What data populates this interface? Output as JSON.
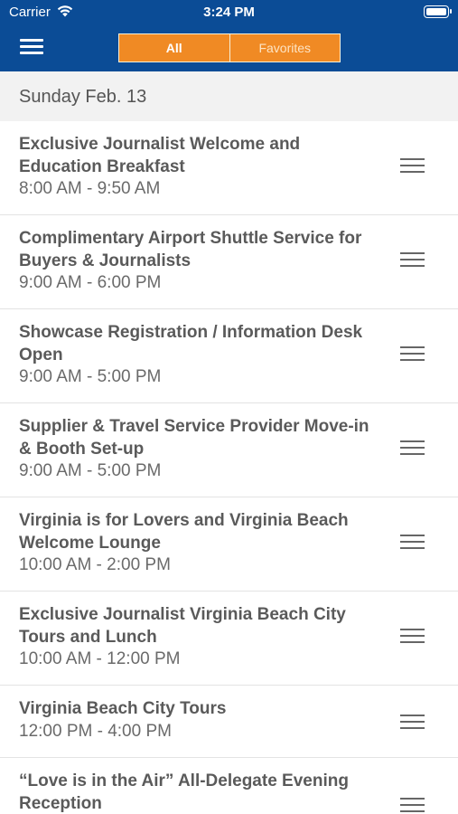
{
  "status_bar": {
    "carrier": "Carrier",
    "time": "3:24 PM"
  },
  "nav": {
    "menu_icon": "hamburger-icon",
    "tabs": [
      {
        "label": "All",
        "active": true
      },
      {
        "label": "Favorites",
        "active": false
      }
    ]
  },
  "day": {
    "label": "Sunday Feb. 13"
  },
  "events": [
    {
      "title": "Exclusive Journalist Welcome and Education Breakfast",
      "time": "8:00 AM - 9:50 AM"
    },
    {
      "title": "Complimentary Airport Shuttle Service for Buyers & Journalists",
      "time": "9:00 AM - 6:00 PM"
    },
    {
      "title": "Showcase Registration / Information Desk Open",
      "time": "9:00 AM - 5:00 PM"
    },
    {
      "title": "Supplier & Travel Service Provider Move-in & Booth Set-up",
      "time": "9:00 AM - 5:00 PM"
    },
    {
      "title": "Virginia is for Lovers and Virginia Beach Welcome Lounge",
      "time": "10:00 AM - 2:00 PM"
    },
    {
      "title": "Exclusive Journalist Virginia Beach City Tours and Lunch",
      "time": "10:00 AM - 12:00 PM"
    },
    {
      "title": "Virginia Beach City Tours",
      "time": "12:00 PM - 4:00 PM"
    },
    {
      "title": "“Love is in the Air” All-Delegate Evening Reception",
      "time": ""
    }
  ],
  "colors": {
    "nav_blue": "#0b4c96",
    "accent_orange": "#f08a24",
    "header_gray": "#f2f2f2"
  }
}
